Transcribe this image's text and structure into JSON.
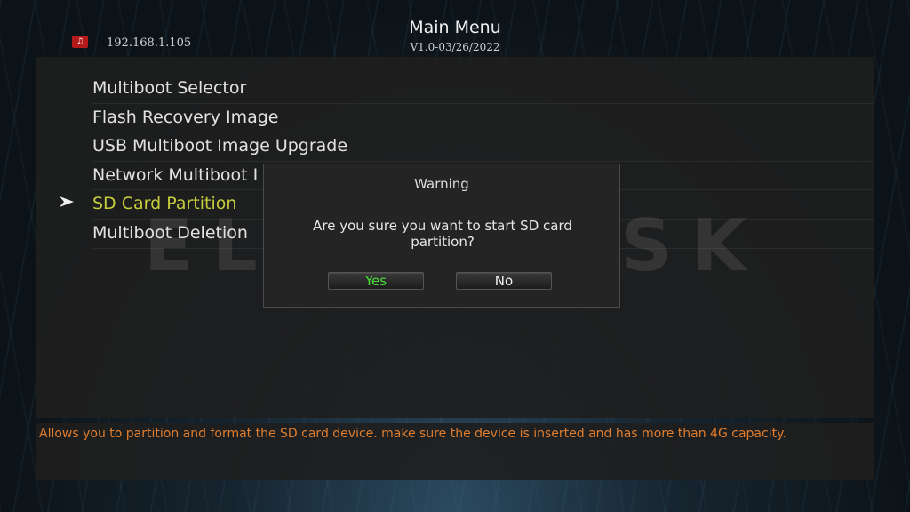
{
  "header": {
    "ip_address": "192.168.1.105",
    "title": "Main Menu",
    "version": "V1.0-03/26/2022",
    "ip_icon": "network-tag-icon"
  },
  "menu": {
    "items": [
      {
        "label": "Multiboot Selector",
        "selected": false
      },
      {
        "label": "Flash Recovery Image",
        "selected": false
      },
      {
        "label": "USB Multiboot Image Upgrade",
        "selected": false
      },
      {
        "label": "Network Multiboot I",
        "selected": false
      },
      {
        "label": "SD Card Partition",
        "selected": true
      },
      {
        "label": "Multiboot Deletion",
        "selected": false
      }
    ],
    "selected_color": "#c6cc3c",
    "selector_icon": "chevron-right-icon"
  },
  "watermark": "ELLANO.SK",
  "dialog": {
    "title": "Warning",
    "message": "Are you sure you want to start SD card partition?",
    "yes_label": "Yes",
    "no_label": "No",
    "yes_color": "#49e03a"
  },
  "description": {
    "text": "Allows you to partition and format the SD card device. make sure the device is inserted and has more than 4G capacity.",
    "color": "#e07d2e"
  }
}
